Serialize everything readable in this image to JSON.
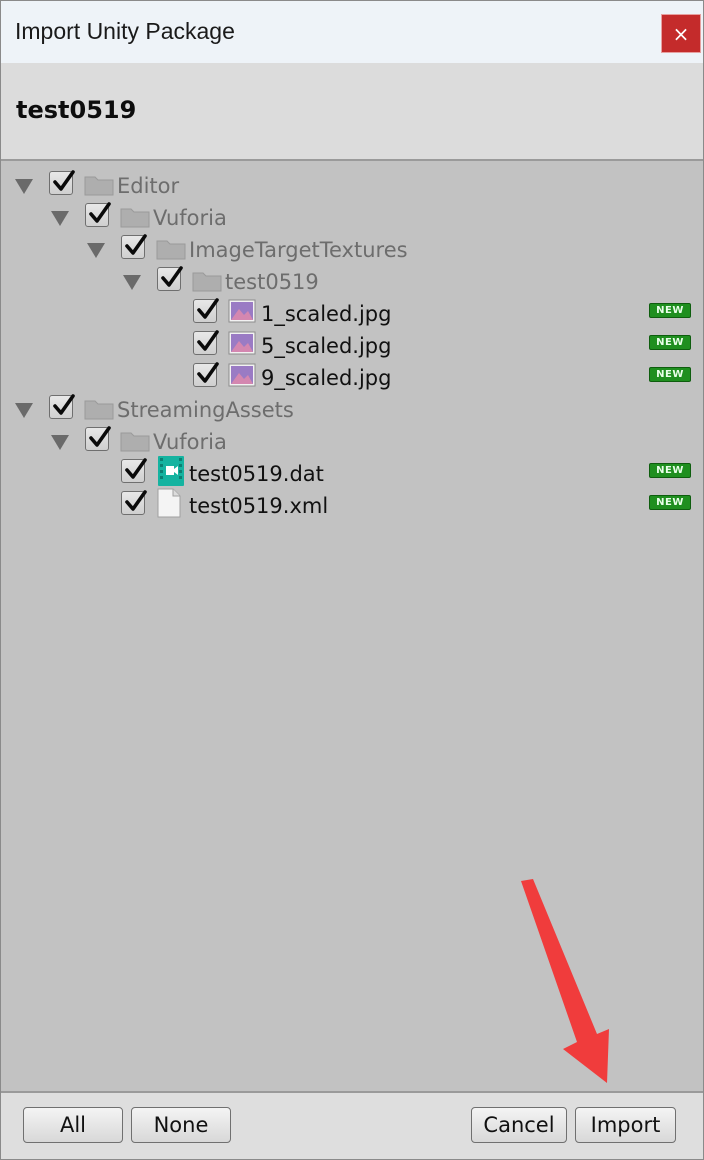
{
  "window": {
    "title": "Import Unity Package",
    "close_glyph": "×"
  },
  "package": {
    "name": "test0519"
  },
  "tree": [
    {
      "label": "Editor",
      "kind": "folder",
      "depth": 0,
      "expanded": true,
      "checked": true,
      "is_new": false
    },
    {
      "label": "Vuforia",
      "kind": "folder",
      "depth": 1,
      "expanded": true,
      "checked": true,
      "is_new": false
    },
    {
      "label": "ImageTargetTextures",
      "kind": "folder",
      "depth": 2,
      "expanded": true,
      "checked": true,
      "is_new": false
    },
    {
      "label": "test0519",
      "kind": "folder",
      "depth": 3,
      "expanded": true,
      "checked": true,
      "is_new": false
    },
    {
      "label": "1_scaled.jpg",
      "kind": "image",
      "depth": 4,
      "expanded": false,
      "checked": true,
      "is_new": true
    },
    {
      "label": "5_scaled.jpg",
      "kind": "image",
      "depth": 4,
      "expanded": false,
      "checked": true,
      "is_new": true
    },
    {
      "label": "9_scaled.jpg",
      "kind": "image",
      "depth": 4,
      "expanded": false,
      "checked": true,
      "is_new": true
    },
    {
      "label": "StreamingAssets",
      "kind": "folder",
      "depth": 0,
      "expanded": true,
      "checked": true,
      "is_new": false
    },
    {
      "label": "Vuforia",
      "kind": "folder",
      "depth": 1,
      "expanded": true,
      "checked": true,
      "is_new": false
    },
    {
      "label": "test0519.dat",
      "kind": "dat",
      "depth": 2,
      "expanded": false,
      "checked": true,
      "is_new": true
    },
    {
      "label": "test0519.xml",
      "kind": "xml",
      "depth": 2,
      "expanded": false,
      "checked": true,
      "is_new": true
    }
  ],
  "badge_text": "NEW",
  "buttons": {
    "all": "All",
    "none": "None",
    "cancel": "Cancel",
    "import": "Import"
  },
  "colors": {
    "close": "#c42b2b",
    "badge": "#1f8f1f",
    "arrow": "#f03c3c"
  }
}
